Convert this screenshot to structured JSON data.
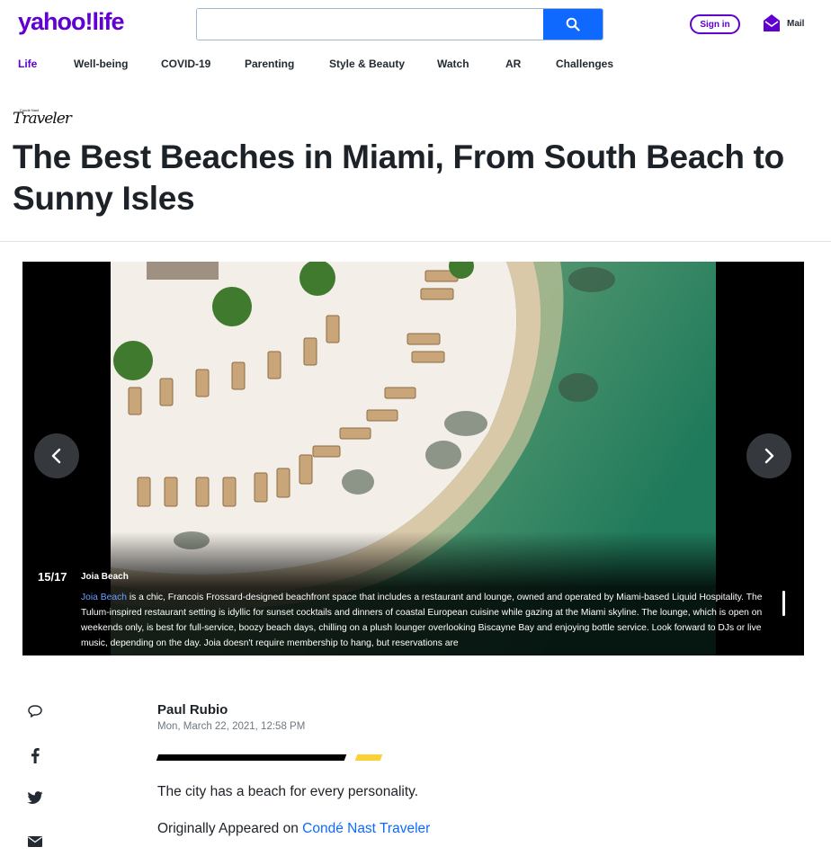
{
  "header": {
    "logo": "yahoo!life",
    "search_placeholder": "",
    "signin_label": "Sign in",
    "mail_label": "Mail"
  },
  "nav": [
    {
      "label": "Life",
      "active": true
    },
    {
      "label": "Well-being"
    },
    {
      "label": "COVID-19"
    },
    {
      "label": "Parenting"
    },
    {
      "label": "Style & Beauty"
    },
    {
      "label": "Watch"
    },
    {
      "label": "AR"
    },
    {
      "label": "Challenges"
    }
  ],
  "article": {
    "brand": "Traveler",
    "brand_small": "Condé Nast",
    "headline": "The Best Beaches in Miami, From South Beach to Sunny Isles",
    "author": "Paul Rubio",
    "date": "Mon, March 22, 2021, 12:58 PM",
    "lede": "The city has a beach for every personality.",
    "originally_prefix": "Originally Appeared on ",
    "originally_link": "Condé Nast Traveler"
  },
  "slideshow": {
    "counter": "15/17",
    "title": "Joia Beach",
    "caption_link": "Joia Beach",
    "caption_text": " is a chic, Francois Frossard-designed beachfront space that includes a restaurant and lounge, owned and operated by Miami-based Liquid Hospitality. The Tulum-inspired restaurant setting is idyllic for sunset cocktails and dinners of coastal European cuisine while gazing at the Miami skyline. The lounge, which is open on weekends only, is best for full-service, boozy beach days, chilling on a plush lounger overlooking Biscayne Bay and enjoying bottle service. Look forward to DJs or live music, depending on the day. Joia doesn't require membership to hang, but reservations are"
  },
  "share_icons": [
    "comment-icon",
    "facebook-icon",
    "twitter-icon",
    "mail-icon"
  ],
  "colors": {
    "brand_purple": "#6001d2",
    "search_blue": "#0f69ff",
    "accent_yellow": "#fbd135"
  }
}
